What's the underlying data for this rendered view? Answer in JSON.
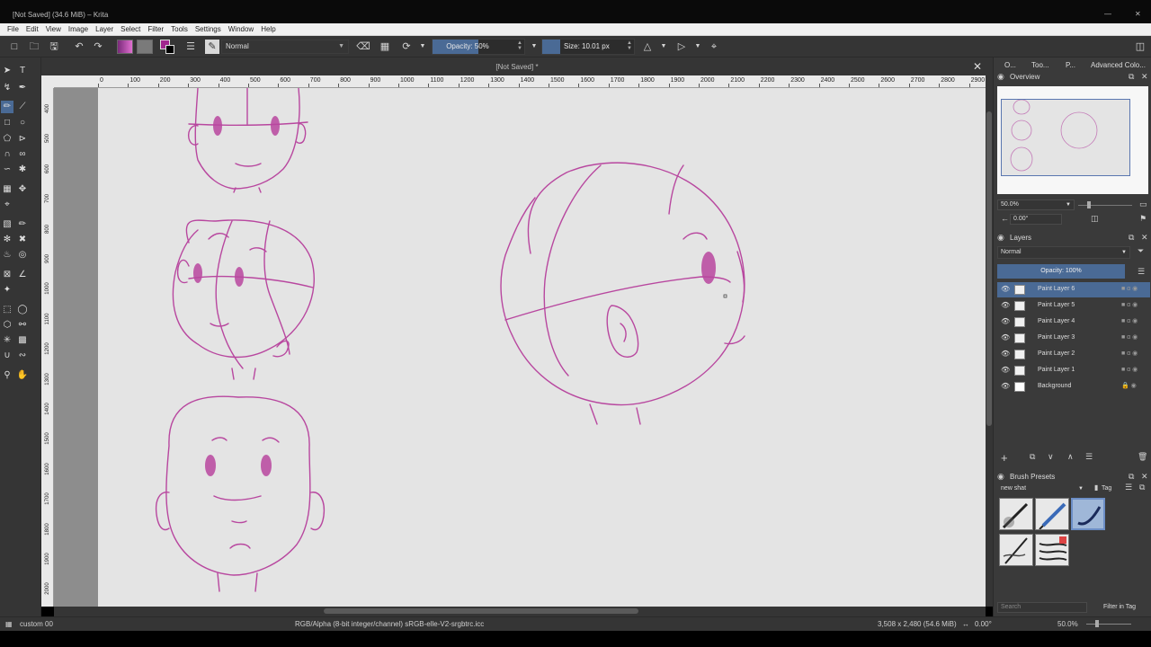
{
  "window": {
    "title": "[Not Saved]  (34.6 MiB)  – Krita"
  },
  "menu": [
    "File",
    "Edit",
    "View",
    "Image",
    "Layer",
    "Select",
    "Filter",
    "Tools",
    "Settings",
    "Window",
    "Help"
  ],
  "toolbar": {
    "blend_mode": "Normal",
    "opacity_label": "Opacity: 50%",
    "opacity_fraction": 0.5,
    "size_label": "Size: 10.01 px"
  },
  "document": {
    "tab_title": "[Not Saved] *"
  },
  "ruler": {
    "h_labels": [
      "0",
      "100",
      "200",
      "300",
      "400",
      "500",
      "600",
      "700",
      "800",
      "900",
      "1000",
      "1100",
      "1200",
      "1300",
      "1400",
      "1500",
      "1600",
      "1700",
      "1800",
      "1900",
      "2000",
      "2100",
      "2200",
      "2300",
      "2400",
      "2500",
      "2600",
      "2700",
      "2800",
      "2900"
    ],
    "v_labels": [
      "400",
      "500",
      "600",
      "700",
      "800",
      "900",
      "1000",
      "1100",
      "1200",
      "1300",
      "1400",
      "1500",
      "1600",
      "1700",
      "1800",
      "1900",
      "2000"
    ]
  },
  "dock": {
    "tabs": [
      "O...",
      "Too...",
      "P...",
      "Advanced Colo..."
    ],
    "overview_title": "Overview",
    "zoom_value": "50.0%",
    "rotation_value": "0.00°",
    "layers_title": "Layers",
    "layer_blend": "Normal",
    "layer_opacity_label": "Opacity:  100%",
    "layers": [
      {
        "name": "Paint Layer 6",
        "selected": true
      },
      {
        "name": "Paint Layer 5",
        "selected": false
      },
      {
        "name": "Paint Layer 4",
        "selected": false
      },
      {
        "name": "Paint Layer 3",
        "selected": false
      },
      {
        "name": "Paint Layer 2",
        "selected": false
      },
      {
        "name": "Paint Layer 1",
        "selected": false
      },
      {
        "name": "Background",
        "selected": false
      }
    ],
    "brush_presets_title": "Brush Presets",
    "brush_tag": "new shat",
    "tag_label": "Tag",
    "search_placeholder": "Search",
    "filter_in_tag": "Filter in Tag"
  },
  "status": {
    "brush_name": "custom 00",
    "color_space": "RGB/Alpha (8-bit integer/channel)  sRGB-elle-V2-srgbtrc.icc",
    "dimensions": "3,508 x 2,480 (54.6 MiB)",
    "rotation": "0.00°",
    "zoom": "50.0%"
  },
  "colors": {
    "accent": "#4a6a95",
    "sketch": "#b8479f",
    "fg_color": "#a0268d",
    "canvas": "#e4e4e4"
  }
}
